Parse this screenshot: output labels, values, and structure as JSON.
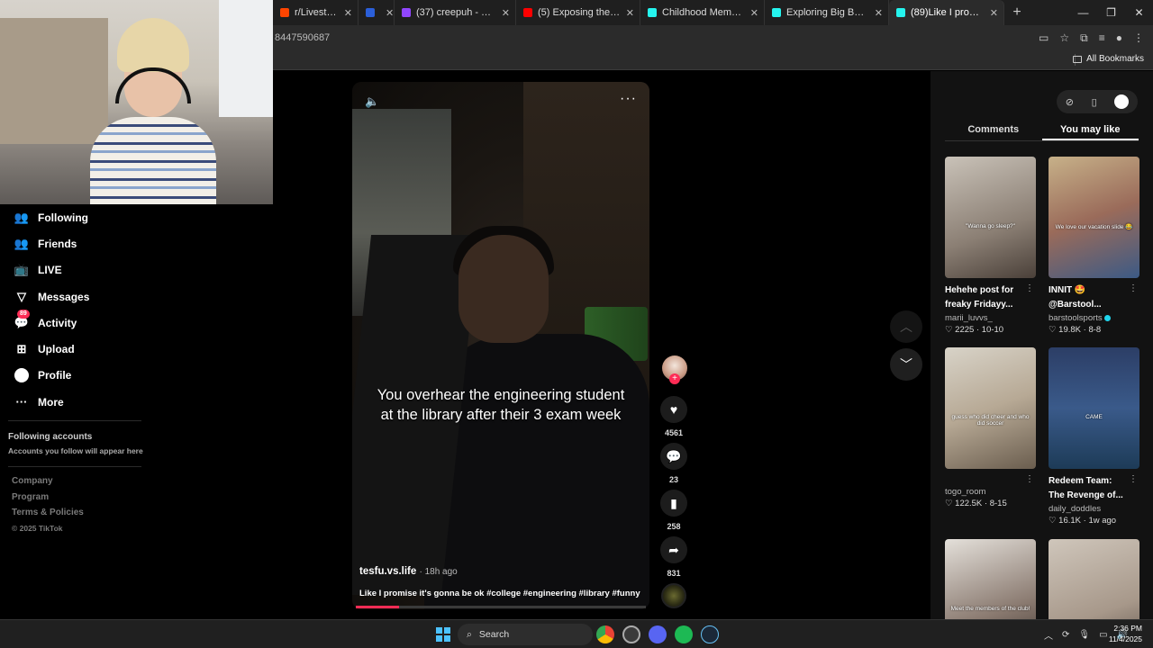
{
  "browser": {
    "tabs": [
      {
        "label": "r/LivestreamFail",
        "color": "#ff4500"
      },
      {
        "label": "",
        "color": "#2b5fd9"
      },
      {
        "label": "(37) creepuh - Twitch",
        "color": "#9146ff"
      },
      {
        "label": "(5) Exposing the Gamblin",
        "color": "#ff0000"
      },
      {
        "label": "Childhood Memories: Ak",
        "color": "#25f4ee"
      },
      {
        "label": "Exploring Big Booty Lee's",
        "color": "#25f4ee"
      },
      {
        "label": "(89)Like I promise it's",
        "color": "#25f4ee"
      }
    ],
    "url": "8447590687",
    "all_bookmarks": "All Bookmarks"
  },
  "sidebar": {
    "items": [
      {
        "label": "Following",
        "icon": "following-icon",
        "glyph": "👥"
      },
      {
        "label": "Friends",
        "icon": "friends-icon",
        "glyph": "👥"
      },
      {
        "label": "LIVE",
        "icon": "live-icon",
        "glyph": "📺"
      },
      {
        "label": "Messages",
        "icon": "messages-icon",
        "glyph": "▽"
      },
      {
        "label": "Activity",
        "icon": "activity-icon",
        "glyph": "💬",
        "badge": "89"
      },
      {
        "label": "Upload",
        "icon": "upload-icon",
        "glyph": "⊞"
      },
      {
        "label": "Profile",
        "icon": "profile-icon",
        "glyph": ""
      },
      {
        "label": "More",
        "icon": "more-icon",
        "glyph": "···"
      }
    ],
    "following_accounts_title": "Following accounts",
    "following_accounts_sub": "Accounts you follow will appear here",
    "footer": [
      "Company",
      "Program",
      "Terms & Policies",
      "© 2025 TikTok"
    ]
  },
  "video": {
    "caption": "You overhear the engineering student at the library after their 3 exam week",
    "author": "tesfu.vs.life",
    "time_ago": "· 18h ago",
    "description": "Like I promise it's gonna be ok #college #engineering #library #funny",
    "progress": 0.15
  },
  "actions": {
    "likes": "4561",
    "comments": "23",
    "saves": "258",
    "shares": "831"
  },
  "panel": {
    "tabs": [
      "Comments",
      "You may like"
    ],
    "active_tab": 1,
    "cards": [
      {
        "title": "Hehehe post for freaky Fridayy...",
        "user": "marii_luvvs_",
        "likes": "2225",
        "date": "10-10",
        "verified": false,
        "thumb_text": "\"Wanna go sleep?\"",
        "bg": "linear-gradient(160deg,#c9c2b8,#8b7f74 60%,#4a4039)"
      },
      {
        "title": "INNIT 🤩 @Barstool...",
        "user": "barstoolsports",
        "likes": "19.8K",
        "date": "8-8",
        "verified": true,
        "thumb_text": "We love our vacation slide 😂",
        "bg": "linear-gradient(160deg,#c7b189,#9a6b5a 50%,#3c5a85)"
      },
      {
        "title": "",
        "user": "togo_room",
        "likes": "122.5K",
        "date": "8-15",
        "verified": false,
        "thumb_text": "guess who did cheer and who did soccer",
        "bg": "linear-gradient(160deg,#d8d3c8,#b7a995 50%,#6a5d4e)"
      },
      {
        "title": "Redeem Team: The Revenge of...",
        "user": "daily_doddles",
        "likes": "16.1K",
        "date": "1w ago",
        "verified": false,
        "thumb_text": "CAME",
        "bg": "linear-gradient(180deg,#2c3e66,#3a5a8a 50%,#1d3b57)"
      },
      {
        "title": "",
        "user": "",
        "likes": "",
        "date": "",
        "verified": false,
        "thumb_text": "Meet the members of the club!",
        "bg": "linear-gradient(160deg,#e4e0da,#8a7a70 60%,#3a302b)"
      },
      {
        "title": "",
        "user": "",
        "likes": "",
        "date": "",
        "verified": false,
        "thumb_text": "",
        "bg": "linear-gradient(160deg,#cfc6bb,#a7988a 60%,#5a4c44)"
      }
    ]
  },
  "taskbar": {
    "search": "Search",
    "time": "2:36 PM",
    "date": "11/4/2025"
  }
}
